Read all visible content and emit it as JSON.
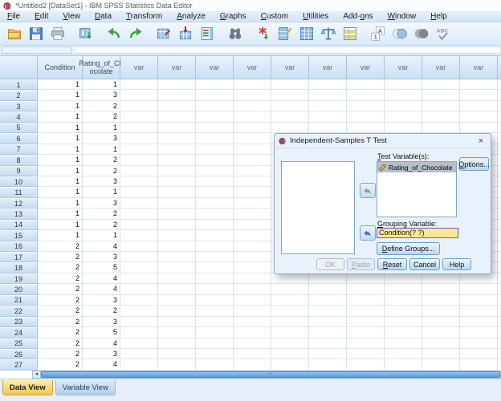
{
  "window": {
    "title": "*Untitled2 [DataSet1] - IBM SPSS Statistics Data Editor"
  },
  "menubar": {
    "items": [
      {
        "label": "File",
        "u": 0
      },
      {
        "label": "Edit",
        "u": 0
      },
      {
        "label": "View",
        "u": 0
      },
      {
        "label": "Data",
        "u": 0
      },
      {
        "label": "Transform",
        "u": 0
      },
      {
        "label": "Analyze",
        "u": 0
      },
      {
        "label": "Graphs",
        "u": 0
      },
      {
        "label": "Custom",
        "u": 0
      },
      {
        "label": "Utilities",
        "u": 0
      },
      {
        "label": "Add-ons",
        "u": 4
      },
      {
        "label": "Window",
        "u": 0
      },
      {
        "label": "Help",
        "u": 0
      }
    ]
  },
  "toolbar": {
    "buttons": [
      {
        "name": "open-file"
      },
      {
        "name": "save"
      },
      {
        "name": "print"
      },
      {
        "name": "recall-dialogs"
      },
      {
        "name": "undo"
      },
      {
        "name": "redo"
      },
      {
        "name": "goto-case"
      },
      {
        "name": "goto-variable"
      },
      {
        "name": "variables"
      },
      {
        "name": "find"
      },
      {
        "name": "insert-cases"
      },
      {
        "name": "insert-variable"
      },
      {
        "name": "split-file"
      },
      {
        "name": "weight-cases"
      },
      {
        "name": "select-cases"
      },
      {
        "name": "value-labels"
      },
      {
        "name": "use-variable-sets"
      },
      {
        "name": "show-all-variables"
      },
      {
        "name": "spell-check"
      }
    ]
  },
  "grid": {
    "columns": [
      {
        "label": "Condition",
        "lines": [
          "Condition"
        ]
      },
      {
        "label": "Rating_of_Chocolate",
        "lines": [
          "Rating_of_Ch",
          "ocolate"
        ]
      }
    ],
    "var_header": "var",
    "var_columns": 11,
    "rows": [
      [
        1,
        1
      ],
      [
        1,
        3
      ],
      [
        1,
        2
      ],
      [
        1,
        2
      ],
      [
        1,
        1
      ],
      [
        1,
        3
      ],
      [
        1,
        1
      ],
      [
        1,
        2
      ],
      [
        1,
        2
      ],
      [
        1,
        3
      ],
      [
        1,
        1
      ],
      [
        1,
        3
      ],
      [
        1,
        2
      ],
      [
        1,
        2
      ],
      [
        1,
        1
      ],
      [
        2,
        4
      ],
      [
        2,
        3
      ],
      [
        2,
        5
      ],
      [
        2,
        4
      ],
      [
        2,
        4
      ],
      [
        2,
        3
      ],
      [
        2,
        2
      ],
      [
        2,
        3
      ],
      [
        2,
        5
      ],
      [
        2,
        4
      ],
      [
        2,
        3
      ],
      [
        2,
        4
      ]
    ]
  },
  "scrollbar": {
    "left_arrow": "◄",
    "grip": "⋯"
  },
  "tabs": {
    "data_view": "Data View",
    "variable_view": "Variable View"
  },
  "dialog": {
    "title": "Independent-Samples T Test",
    "close": "×",
    "test_variables_label": "Test Variable(s):",
    "test_variables": [
      {
        "name": "Rating_of_Chocolate",
        "measure": "scale"
      }
    ],
    "grouping_label": "Grouping Variable:",
    "grouping_value": "Condition(? ?)",
    "buttons": {
      "options": "Options...",
      "define_groups": "Define Groups...",
      "ok": "OK",
      "paste": "Paste",
      "reset": "Reset",
      "cancel": "Cancel",
      "help": "Help"
    }
  },
  "colors": {
    "menu_bg": "#d9e8f7",
    "header_cell_blue": "#cbdff3",
    "grid_line": "#d5e3f1",
    "tab_active_amber": "#f6c653",
    "tab_inactive_blue": "#b2cfea",
    "grouping_field_yellow": "#fbe88f",
    "grouping_field_border_purple": "#6a5acd",
    "selected_item_grey": "#b7bec6",
    "accent_blue": "#4a86c0"
  }
}
